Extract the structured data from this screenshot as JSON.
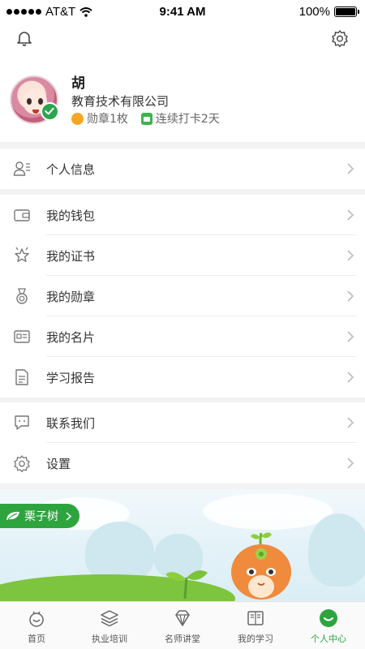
{
  "status_bar": {
    "carrier": "AT&T",
    "time": "9:41 AM",
    "battery": "100%"
  },
  "profile": {
    "name": "胡",
    "company": "教育技术有限公司",
    "medal_text": "勋章1枚",
    "checkin_text": "连续打卡2天"
  },
  "menu": {
    "personal_info": "个人信息",
    "wallet": "我的钱包",
    "certificates": "我的证书",
    "medals": "我的勋章",
    "business_card": "我的名片",
    "study_report": "学习报告",
    "contact_us": "联系我们",
    "settings": "设置"
  },
  "banner": {
    "pill_label": "栗子树"
  },
  "tabbar": {
    "tabs": [
      {
        "label": "首页",
        "icon": "home-icon"
      },
      {
        "label": "执业培训",
        "icon": "layers-icon"
      },
      {
        "label": "名师讲堂",
        "icon": "diamond-icon"
      },
      {
        "label": "我的学习",
        "icon": "book-icon"
      },
      {
        "label": "个人中心",
        "icon": "profile-icon"
      }
    ],
    "active_index": 4
  },
  "colors": {
    "accent": "#2ea43f",
    "badge_gold": "#f5a623"
  }
}
